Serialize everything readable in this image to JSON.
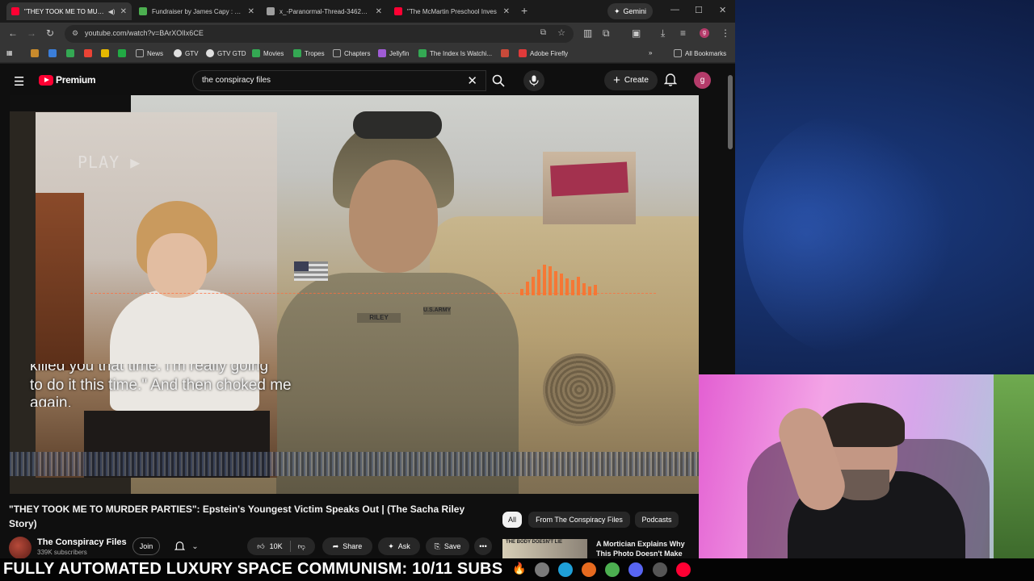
{
  "browser": {
    "tabs": [
      {
        "title": "\"THEY TOOK ME TO MURD",
        "favicon_color": "#ff0033",
        "active": true,
        "muted_icon": "speaker-icon"
      },
      {
        "title": "Fundraiser by James Capy : Sup",
        "favicon_color": "#4caf50",
        "active": false
      },
      {
        "title": "x_-Paranormal-Thread-3462956",
        "favicon_color": "#9e9e9e",
        "active": false
      },
      {
        "title": "\"The McMartin Preschool Inves",
        "favicon_color": "#ff0033",
        "active": false
      }
    ],
    "gemini_label": "Gemini",
    "url": "youtube.com/watch?v=BArXOlIx6CE",
    "profile_letter": "g",
    "bookmarks": [
      {
        "label": "",
        "color": "#c88a2c"
      },
      {
        "label": "",
        "color": "#3b7ed9"
      },
      {
        "label": "",
        "color": "#34a853"
      },
      {
        "label": "",
        "color": "#ea4335"
      },
      {
        "label": "",
        "color": "#e6b800"
      },
      {
        "label": "",
        "color": "#22aa44"
      },
      {
        "label": "News",
        "color": "#8f8f8f"
      },
      {
        "label": "GTV",
        "color": "#e0e0e0"
      },
      {
        "label": "GTV GTD",
        "color": "#e0e0e0"
      },
      {
        "label": "Movies",
        "color": "#34a853"
      },
      {
        "label": "Tropes",
        "color": "#34a853"
      },
      {
        "label": "Chapters",
        "color": "#8f8f8f"
      },
      {
        "label": "Jellyfin",
        "color": "#a05cd6"
      },
      {
        "label": "The Index Is Watchi...",
        "color": "#34a853"
      },
      {
        "label": "",
        "color": "#c94a3a"
      },
      {
        "label": "Adobe Firefly",
        "color": "#e03a3a"
      }
    ],
    "all_bookmarks": "All Bookmarks"
  },
  "youtube": {
    "logo_text": "Premium",
    "search_value": "the conspiracy files",
    "create_label": "Create",
    "avatar_letter": "g",
    "video": {
      "vhs_label": "PLAY ▶",
      "caption_lines": [
        "killed you that time. I'm really going",
        "to do it this time.\" And then choked me",
        "again."
      ],
      "name_tag": "RILEY",
      "army_tag": "U.S.ARMY",
      "eq_levels": [
        0.2,
        0.45,
        0.6,
        0.85,
        1.0,
        0.95,
        0.8,
        0.7,
        0.55,
        0.5,
        0.6,
        0.4,
        0.3,
        0.35
      ]
    },
    "title": "\"THEY TOOK ME TO MURDER PARTIES\": Epstein's Youngest Victim Speaks Out | (The Sacha Riley Story)",
    "channel": {
      "name": "The Conspiracy Files",
      "subs": "339K subscribers"
    },
    "join_label": "Join",
    "like_count": "10K",
    "share_label": "Share",
    "ask_label": "Ask",
    "save_label": "Save",
    "chips": [
      "All",
      "From The Conspiracy Files",
      "Podcasts"
    ],
    "recommendation": {
      "thumb_text": "THE BODY DOESN'T LIE",
      "title": "A Mortician Explains Why This Photo Doesn't Make Sense"
    }
  },
  "ticker": {
    "text": "FULLY AUTOMATED LUXURY SPACE COMMUNISM: 10/11 SUBS",
    "emoji": "🔥"
  },
  "taskbar_icons": [
    {
      "name": "github-icon",
      "color": "#7a7a7a"
    },
    {
      "name": "edge-icon",
      "color": "#1fa0d8"
    },
    {
      "name": "firefox-icon",
      "color": "#e66a1f"
    },
    {
      "name": "chrome-icon",
      "color": "#4caf50"
    },
    {
      "name": "discord-icon",
      "color": "#5865f2"
    },
    {
      "name": "obs-icon",
      "color": "#555555"
    },
    {
      "name": "youtube-icon",
      "color": "#ff0033"
    }
  ]
}
